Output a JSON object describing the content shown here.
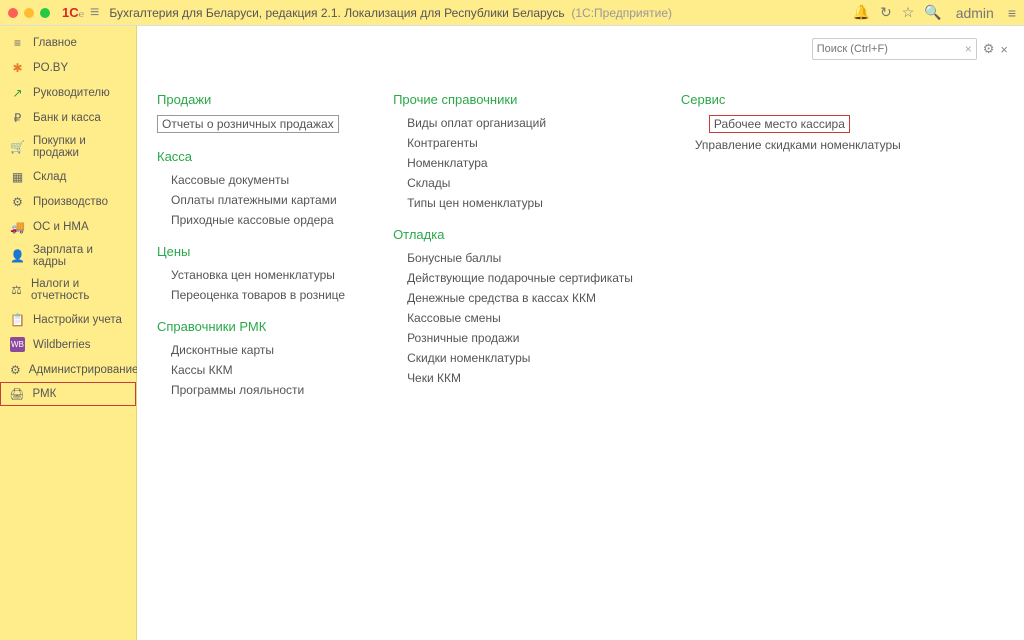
{
  "header": {
    "logo": "1C",
    "title": "Бухгалтерия для Беларуси, редакция 2.1. Локализация для Республики Беларусь",
    "subtitle": "(1C:Предприятие)",
    "user": "admin"
  },
  "search": {
    "placeholder": "Поиск (Ctrl+F)"
  },
  "sidebar": {
    "items": [
      {
        "label": "Главное",
        "icon": "≡"
      },
      {
        "label": "PO.BY",
        "icon": "✱"
      },
      {
        "label": "Руководителю",
        "icon": "↗"
      },
      {
        "label": "Банк и касса",
        "icon": "₽"
      },
      {
        "label": "Покупки и продажи",
        "icon": "🛒"
      },
      {
        "label": "Склад",
        "icon": "▦"
      },
      {
        "label": "Производство",
        "icon": "⚙"
      },
      {
        "label": "ОС и НМА",
        "icon": "🚚"
      },
      {
        "label": "Зарплата и кадры",
        "icon": "👤"
      },
      {
        "label": "Налоги и отчетность",
        "icon": "⚖"
      },
      {
        "label": "Настройки учета",
        "icon": "📋"
      },
      {
        "label": "Wildberries",
        "icon": "WB"
      },
      {
        "label": "Администрирование",
        "icon": "⚙"
      },
      {
        "label": "РМК",
        "icon": "🖨"
      }
    ]
  },
  "columns": [
    {
      "sections": [
        {
          "title": "Продажи",
          "items": [
            {
              "text": "Отчеты о розничных продажах",
              "boxed": true
            }
          ]
        },
        {
          "title": "Касса",
          "items": [
            {
              "text": "Кассовые документы"
            },
            {
              "text": "Оплаты платежными картами"
            },
            {
              "text": "Приходные кассовые ордера"
            }
          ]
        },
        {
          "title": "Цены",
          "items": [
            {
              "text": "Установка цен номенклатуры"
            },
            {
              "text": "Переоценка товаров в рознице"
            }
          ]
        },
        {
          "title": "Справочники РМК",
          "items": [
            {
              "text": "Дисконтные карты"
            },
            {
              "text": "Кассы ККМ"
            },
            {
              "text": "Программы лояльности"
            }
          ]
        }
      ]
    },
    {
      "sections": [
        {
          "title": "Прочие справочники",
          "items": [
            {
              "text": "Виды оплат организаций"
            },
            {
              "text": "Контрагенты"
            },
            {
              "text": "Номенклатура"
            },
            {
              "text": "Склады"
            },
            {
              "text": "Типы цен номенклатуры"
            }
          ]
        },
        {
          "title": "Отладка",
          "items": [
            {
              "text": "Бонусные баллы"
            },
            {
              "text": "Действующие подарочные сертификаты"
            },
            {
              "text": "Денежные средства в кассах ККМ"
            },
            {
              "text": "Кассовые смены"
            },
            {
              "text": "Розничные продажи"
            },
            {
              "text": "Скидки номенклатуры"
            },
            {
              "text": "Чеки ККМ"
            }
          ]
        }
      ]
    },
    {
      "sections": [
        {
          "title": "Сервис",
          "items": [
            {
              "text": "Рабочее место кассира",
              "highlighted": true
            },
            {
              "text": "Управление скидками номенклатуры"
            }
          ]
        }
      ]
    }
  ]
}
